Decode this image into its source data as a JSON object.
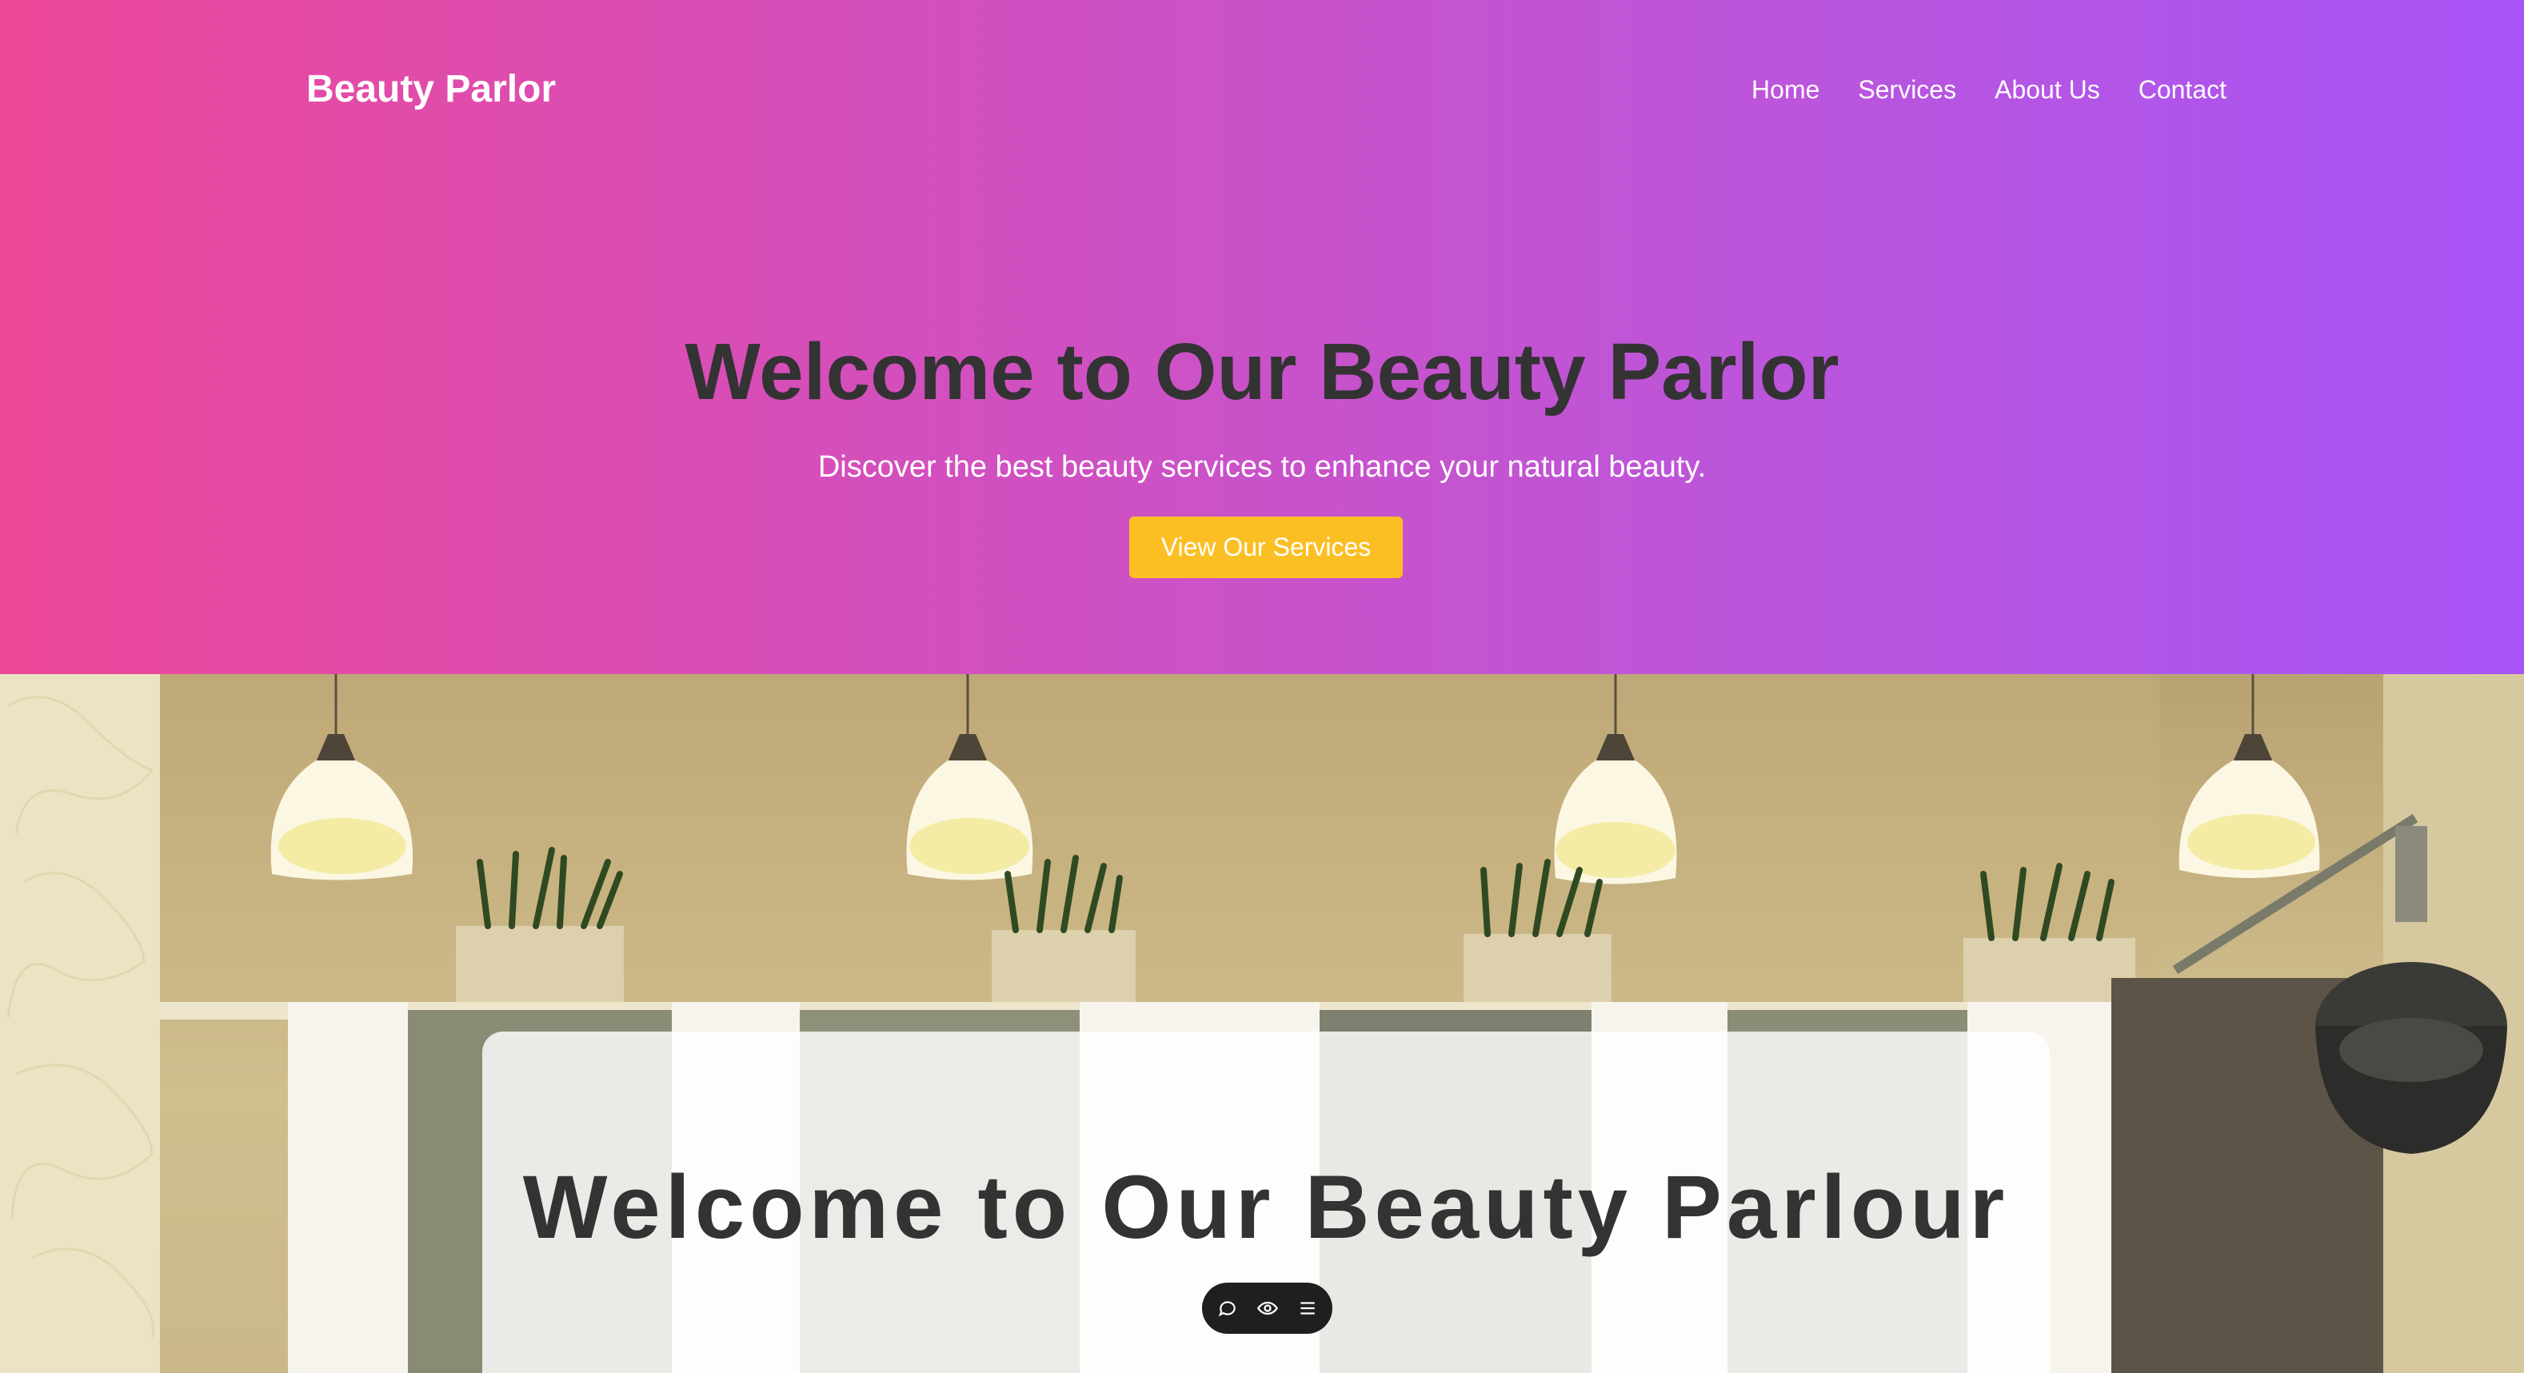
{
  "nav": {
    "brand": "Beauty Parlor",
    "links": [
      "Home",
      "Services",
      "About Us",
      "Contact"
    ]
  },
  "hero": {
    "title": "Welcome to Our Beauty Parlor",
    "subtitle": "Discover the best beauty services to enhance your natural beauty.",
    "cta_label": "View Our Services",
    "gradient_start": "#ec4899",
    "gradient_end": "#a855f7",
    "cta_color": "#fbbf24",
    "title_color": "#333333"
  },
  "salon_section": {
    "card_title": "Welcome to Our Beauty Parlour"
  },
  "toolbar": {
    "icons": [
      "comment-icon",
      "eye-icon",
      "menu-icon"
    ]
  }
}
